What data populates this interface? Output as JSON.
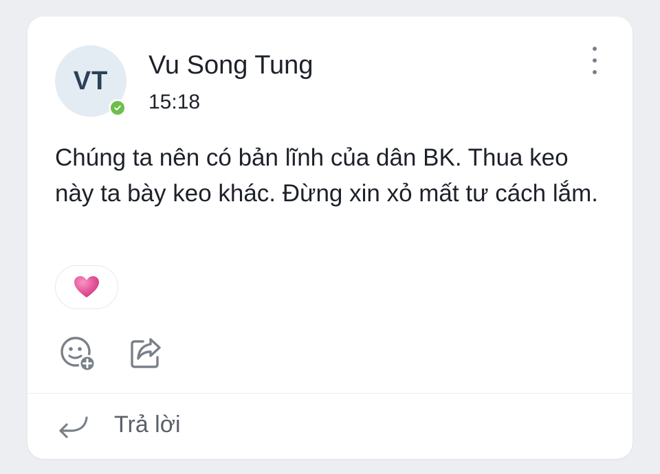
{
  "message": {
    "avatar_initials": "VT",
    "sender_name": "Vu Song Tung",
    "timestamp": "15:18",
    "text": "Chúng ta nên có bản lĩnh của dân BK. Thua keo này ta bày keo khác. Đừng xin xỏ mất tư cách lắm.",
    "online_status_icon": "check-badge-icon",
    "reactions": [
      {
        "icon": "pink-heart-icon",
        "color": "#e5559a"
      }
    ]
  },
  "actions": {
    "react_icon": "add-emoji-icon",
    "share_icon": "share-icon",
    "more_icon": "more-vertical-icon"
  },
  "reply": {
    "icon": "reply-arrow-icon",
    "label": "Trả lời"
  },
  "colors": {
    "avatar_bg": "#e3ebf3",
    "online_green": "#6cbf4a",
    "text": "#1d2129",
    "icon_gray": "#7a8089"
  }
}
